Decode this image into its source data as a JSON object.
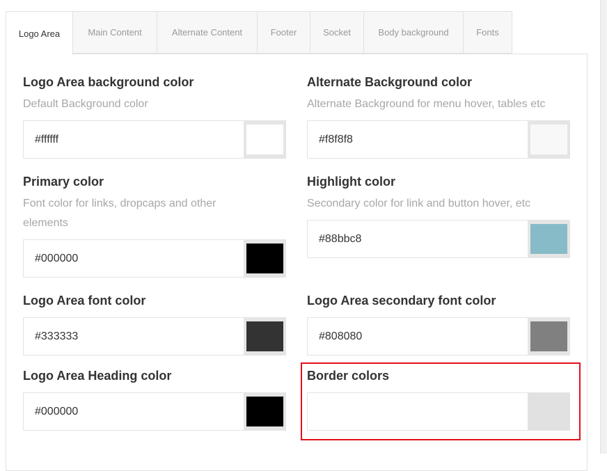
{
  "tabs": [
    {
      "label": "Logo Area",
      "active": true
    },
    {
      "label": "Main Content",
      "active": false
    },
    {
      "label": "Alternate Content",
      "active": false
    },
    {
      "label": "Footer",
      "active": false
    },
    {
      "label": "Socket",
      "active": false
    },
    {
      "label": "Body background",
      "active": false
    },
    {
      "label": "Fonts",
      "active": false
    }
  ],
  "fields": {
    "bg": {
      "title": "Logo Area background color",
      "desc": "Default Background color",
      "value": "#ffffff",
      "swatch": "#ffffff"
    },
    "alt_bg": {
      "title": "Alternate Background color",
      "desc": "Alternate Background for menu hover, tables etc",
      "value": "#f8f8f8",
      "swatch": "#f8f8f8"
    },
    "primary": {
      "title": "Primary color",
      "desc": "Font color for links, dropcaps and other elements",
      "value": "#000000",
      "swatch": "#000000"
    },
    "highlight": {
      "title": "Highlight color",
      "desc": "Secondary color for link and button hover, etc",
      "value": "#88bbc8",
      "swatch": "#88bbc8"
    },
    "font": {
      "title": "Logo Area font color",
      "value": "#333333",
      "swatch": "#333333"
    },
    "secondary_font": {
      "title": "Logo Area secondary font color",
      "value": "#808080",
      "swatch": "#808080"
    },
    "heading": {
      "title": "Logo Area Heading color",
      "value": "#000000",
      "swatch": "#000000"
    },
    "border": {
      "title": "Border colors",
      "value": "",
      "swatch": "#e1e1e1"
    }
  },
  "colors": {
    "highlight_outline": "#e3101a"
  }
}
